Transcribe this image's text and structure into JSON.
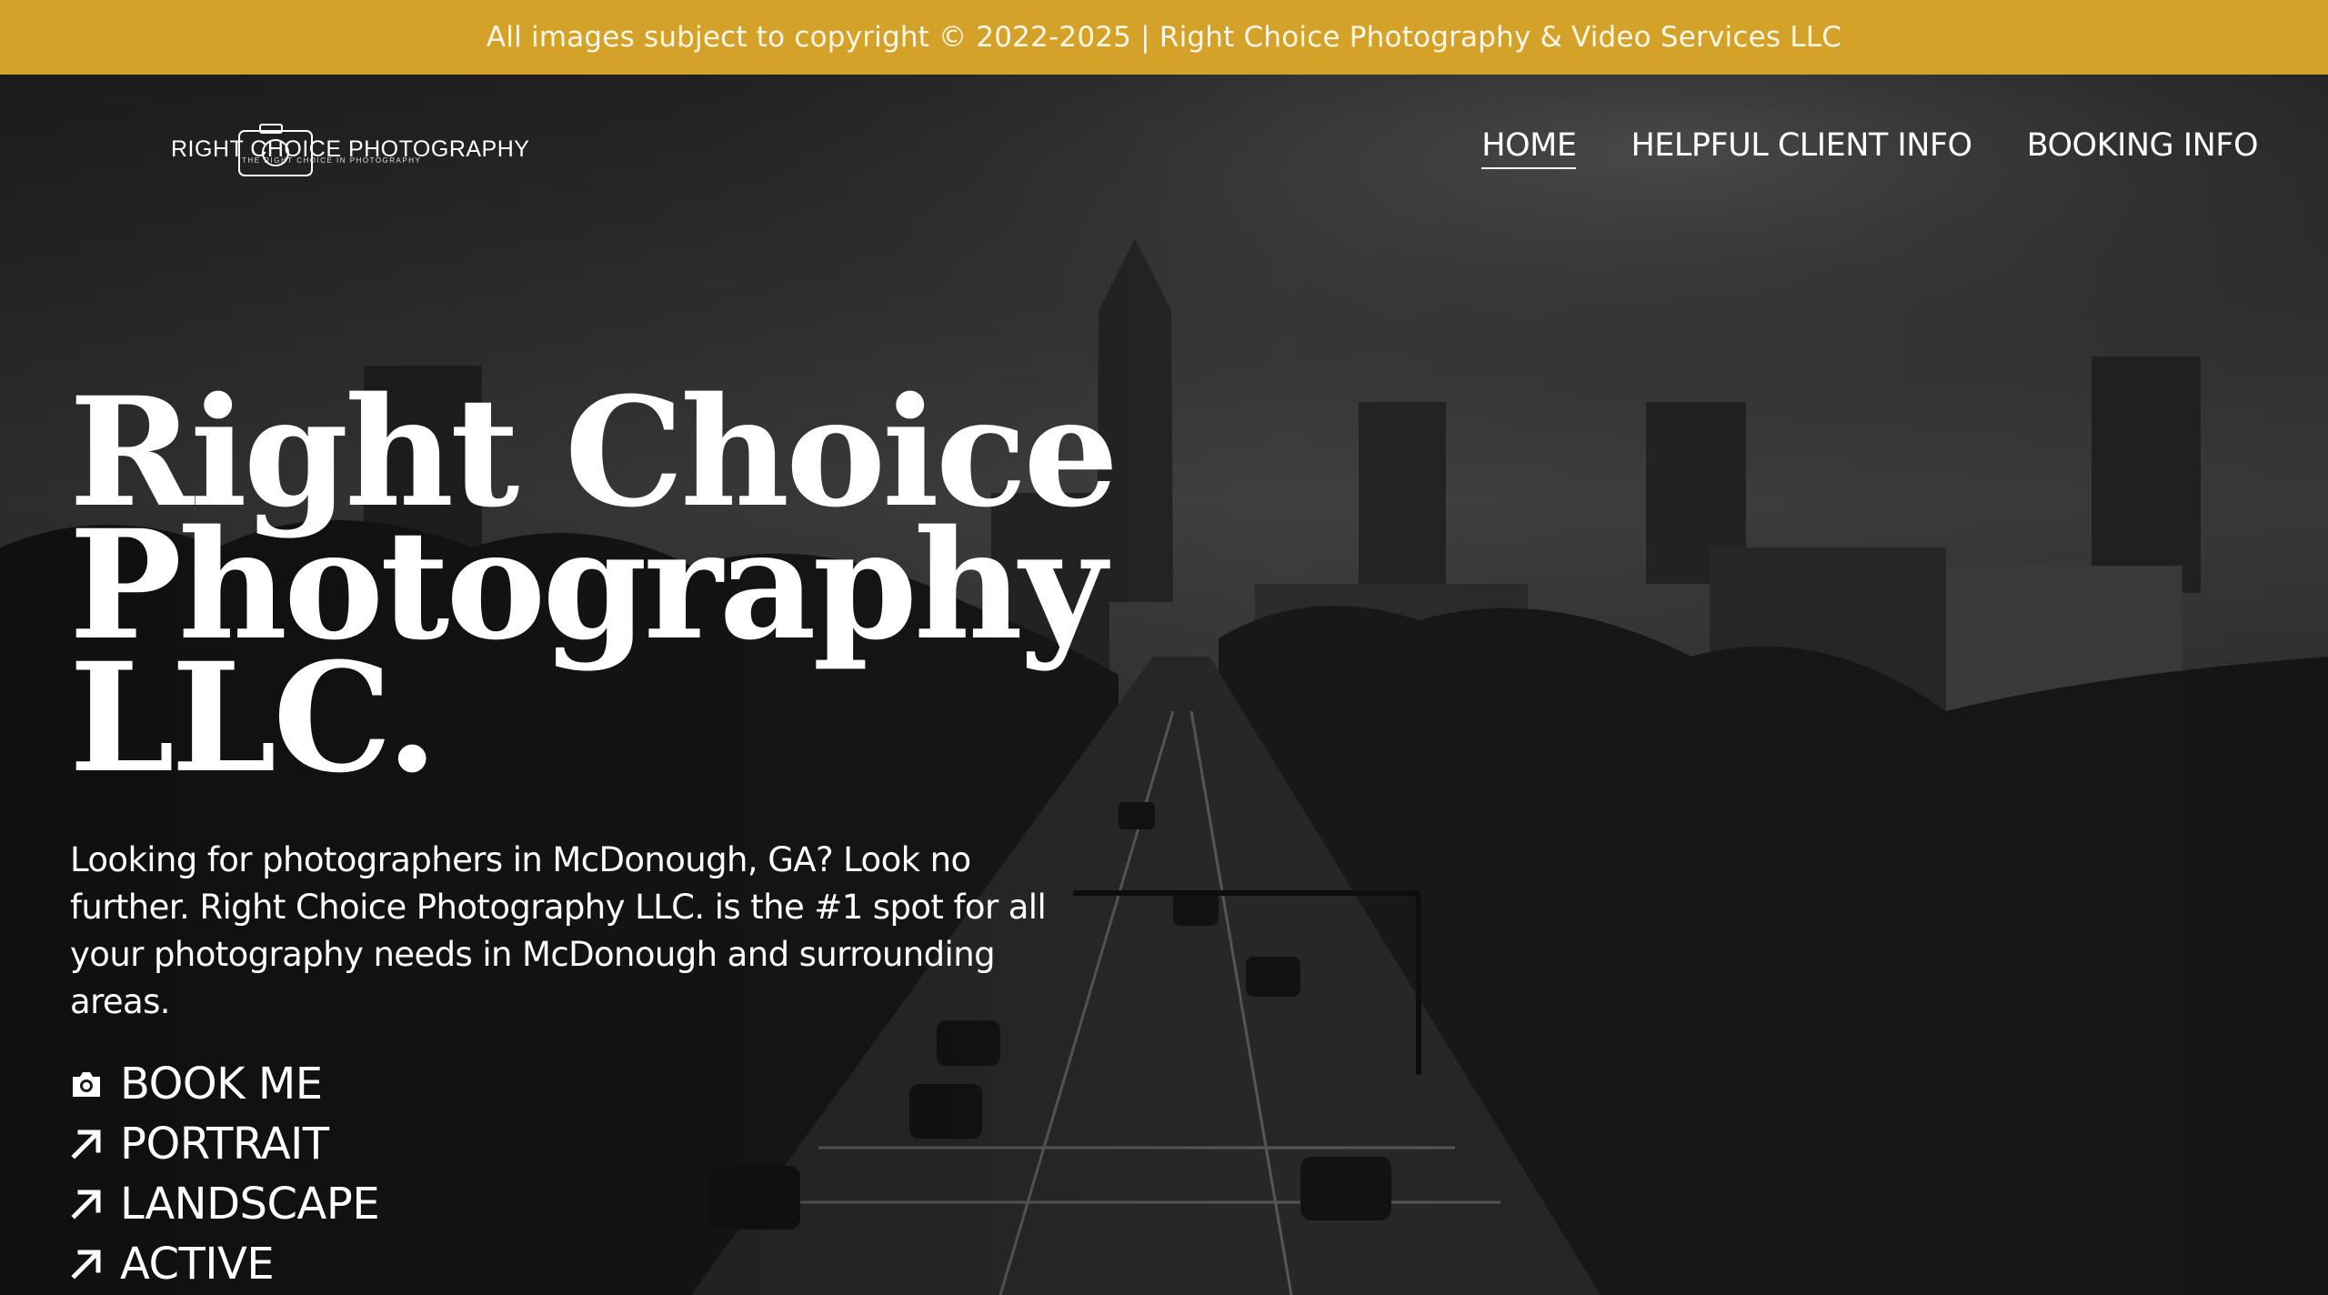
{
  "banner": {
    "text": "All images subject to copyright © 2022-2025 | Right Choice Photography & Video Services LLC"
  },
  "logo": {
    "text": "RIGHT CHOICE PHOTOGRAPHY",
    "tagline": "THE RIGHT CHOICE IN PHOTOGRAPHY"
  },
  "nav": {
    "items": [
      {
        "label": "HOME",
        "active": true
      },
      {
        "label": "HELPFUL CLIENT INFO"
      },
      {
        "label": "BOOKING INFO"
      }
    ]
  },
  "hero": {
    "title_lines": [
      "Right Choice",
      "Photography",
      "LLC."
    ],
    "description": "Looking for photographers in McDonough, GA? Look no further. Right Choice Photography LLC. is the #1 spot for all your photography needs in McDonough and surrounding areas.",
    "links": [
      {
        "label": "BOOK ME",
        "icon": "camera-icon"
      },
      {
        "label": "PORTRAIT",
        "icon": "arrow-up-right-icon"
      },
      {
        "label": "LANDSCAPE",
        "icon": "arrow-up-right-icon"
      },
      {
        "label": "ACTIVE",
        "icon": "arrow-up-right-icon"
      }
    ]
  },
  "colors": {
    "banner": "#d4a228",
    "text": "#ffffff"
  }
}
